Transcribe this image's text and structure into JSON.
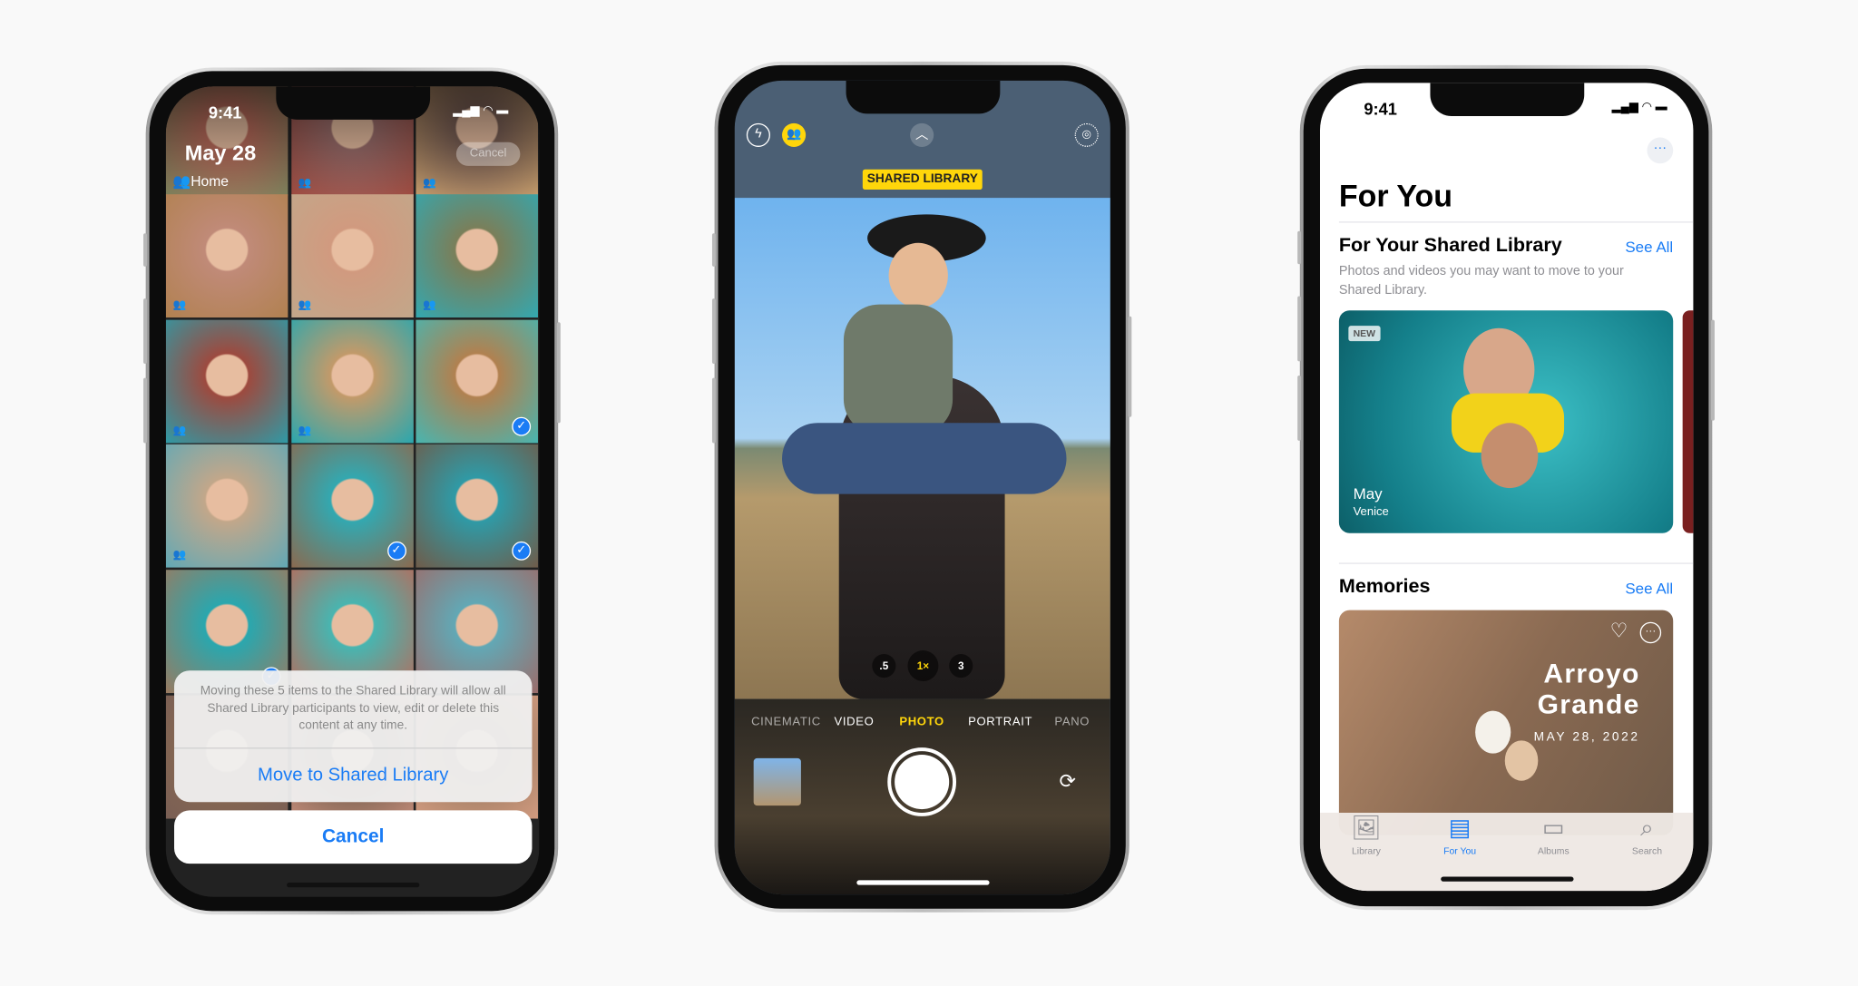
{
  "colors": {
    "accent": "#1a7cf5",
    "camera_yellow": "#ffd60a",
    "background": "#f9f9f9"
  },
  "phone_left": {
    "status_time": "9:41",
    "date_title": "May 28",
    "location": "Home",
    "cancel_label": "Cancel",
    "people_icon": "people-icon",
    "check_icon": "checkmark-icon",
    "sheet": {
      "message": "Moving these 5 items to the Shared Library will allow all Shared Library participants to view, edit or delete this content at any time.",
      "action_label": "Move to Shared Library",
      "cancel_label": "Cancel"
    }
  },
  "phone_middle": {
    "badge": "SHARED LIBRARY",
    "icons": [
      "flash-icon",
      "shared-library-icon",
      "chevron-up-icon",
      "live-photo-icon",
      "flip-camera-icon"
    ],
    "zoom_levels": [
      ".5",
      "1×",
      "3"
    ],
    "modes": [
      "CINEMATIC",
      "VIDEO",
      "PHOTO",
      "PORTRAIT",
      "PANO"
    ],
    "selected_mode": "PHOTO"
  },
  "phone_right": {
    "status_time": "9:41",
    "title": "For You",
    "shared_section": {
      "title": "For Your Shared Library",
      "see_all": "See All",
      "description": "Photos and videos you may want to move to your Shared Library.",
      "card": {
        "badge": "NEW",
        "title": "May",
        "subtitle": "Venice"
      }
    },
    "memories_section": {
      "title": "Memories",
      "see_all": "See All",
      "card": {
        "title_line1": "Arroyo",
        "title_line2": "Grande",
        "date": "MAY 28, 2022"
      }
    },
    "tabs": [
      {
        "label": "Library",
        "icon": "library-icon"
      },
      {
        "label": "For You",
        "icon": "for-you-icon",
        "active": true
      },
      {
        "label": "Albums",
        "icon": "albums-icon"
      },
      {
        "label": "Search",
        "icon": "search-icon"
      }
    ]
  }
}
